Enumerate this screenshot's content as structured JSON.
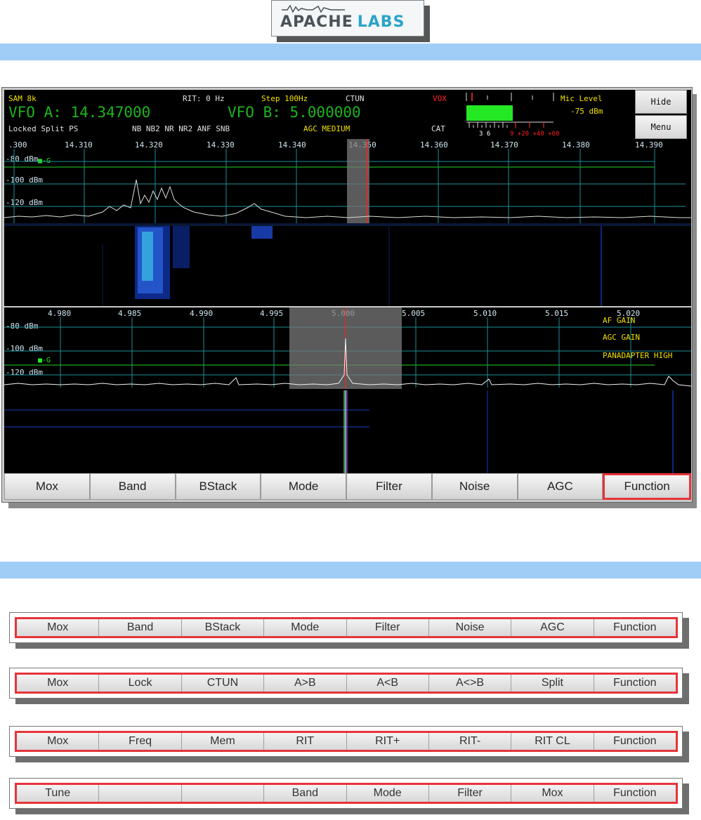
{
  "logo": {
    "word1": "APACHE",
    "word2": "LABS"
  },
  "colors": {
    "accent": "#e6343a",
    "section_bar": "#9fcdf6",
    "vfo_green": "#1db41d",
    "label_yellow": "#f0e000",
    "grid": "#1a8f99"
  },
  "sdr": {
    "mode": "SAM 8k",
    "rit": "RIT: 0 Hz",
    "step": "Step 100Hz",
    "ctun": "CTUN",
    "vox": "VOX",
    "mic_level_label": "Mic Level",
    "mic_level_value": "-75 dBm",
    "vfo_a": "VFO A: 14.347000",
    "vfo_b": "VFO B: 5.000000",
    "status_left": "Locked Split  PS",
    "status_nb": "NB  NB2 NR  NR2 ANF SNB",
    "agc": "AGC MEDIUM",
    "cat": "CAT",
    "meter_scale_white": "3  6",
    "meter_scale_red": "9 +20 +40 +60",
    "hide_label": "Hide",
    "menu_label": "Menu",
    "pan1_freqs": [
      ".300",
      "14.310",
      "14.320",
      "14.330",
      "14.340",
      "14.350",
      "14.360",
      "14.370",
      "14.380",
      "14.390"
    ],
    "pan2_freqs": [
      "4.980",
      "4.985",
      "4.990",
      "4.995",
      "5.000",
      "5.005",
      "5.010",
      "5.015",
      "5.020"
    ],
    "dbm_labels": [
      "-80 dBm",
      "-100 dBm",
      "-120 dBm"
    ],
    "marker_label": "■-G",
    "pan2_notes": [
      "AF GAIN",
      "AGC GAIN",
      "PANADAPTER HIGH"
    ],
    "buttons": [
      "Mox",
      "Band",
      "BStack",
      "Mode",
      "Filter",
      "Noise",
      "AGC",
      "Function"
    ]
  },
  "bars": [
    [
      "Mox",
      "Band",
      "BStack",
      "Mode",
      "Filter",
      "Noise",
      "AGC",
      "Function"
    ],
    [
      "Mox",
      "Lock",
      "CTUN",
      "A>B",
      "A<B",
      "A<>B",
      "Split",
      "Function"
    ],
    [
      "Mox",
      "Freq",
      "Mem",
      "RIT",
      "RIT+",
      "RIT-",
      "RIT CL",
      "Function"
    ],
    [
      "Tune",
      "",
      "",
      "Band",
      "Mode",
      "Filter",
      "Mox",
      "Function"
    ]
  ]
}
